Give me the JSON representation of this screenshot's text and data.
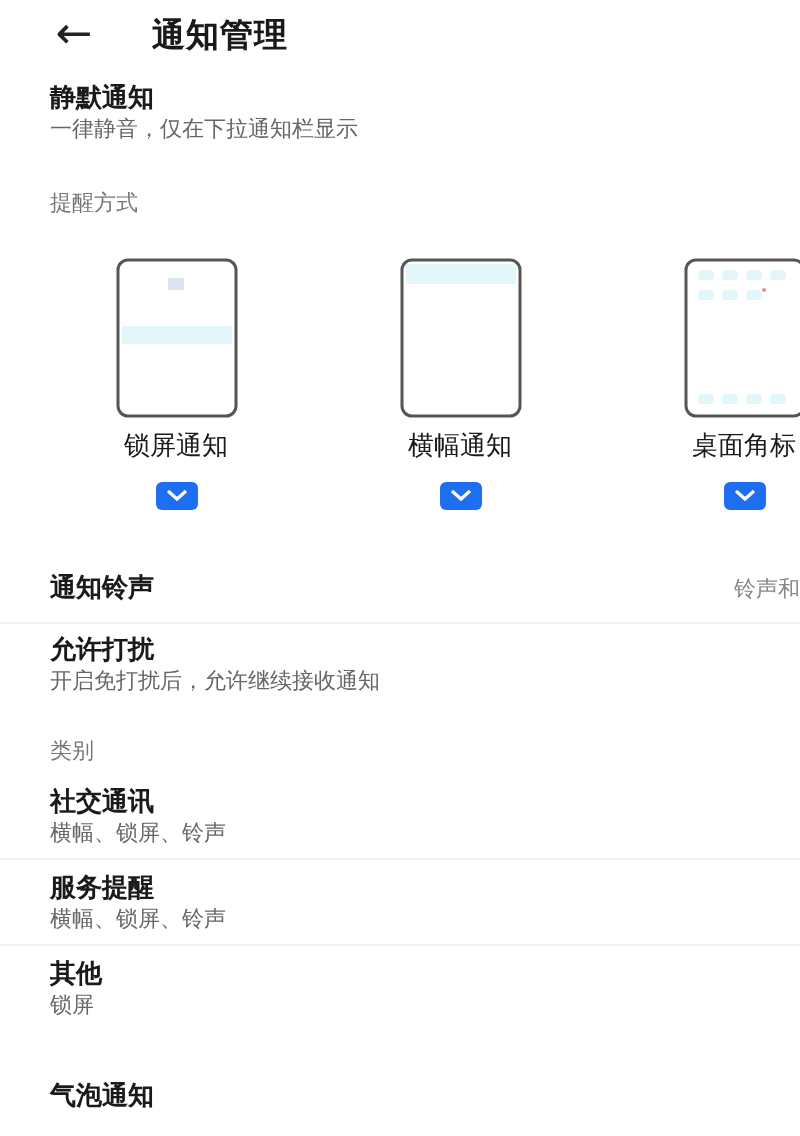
{
  "header": {
    "back": "←",
    "title": "通知管理"
  },
  "silent": {
    "title": "静默通知",
    "subtitle": "一律静音，仅在下拉通知栏显示"
  },
  "reminder_section": {
    "label": "提醒方式"
  },
  "reminder_modes": [
    {
      "kind": "lockscreen",
      "label": "锁屏通知",
      "checked": true
    },
    {
      "kind": "banner",
      "label": "横幅通知",
      "checked": true
    },
    {
      "kind": "badge",
      "label": "桌面角标",
      "checked": true
    }
  ],
  "ringtone": {
    "title": "通知铃声",
    "value": "铃声和"
  },
  "dnd": {
    "title": "允许打扰",
    "subtitle": "开启免打扰后，允许继续接收通知"
  },
  "category_section": {
    "label": "类别"
  },
  "categories": [
    {
      "title": "社交通讯",
      "subtitle": "横幅、锁屏、铃声"
    },
    {
      "title": "服务提醒",
      "subtitle": "横幅、锁屏、铃声"
    },
    {
      "title": "其他",
      "subtitle": "锁屏"
    }
  ],
  "bubble": {
    "title": "气泡通知"
  }
}
